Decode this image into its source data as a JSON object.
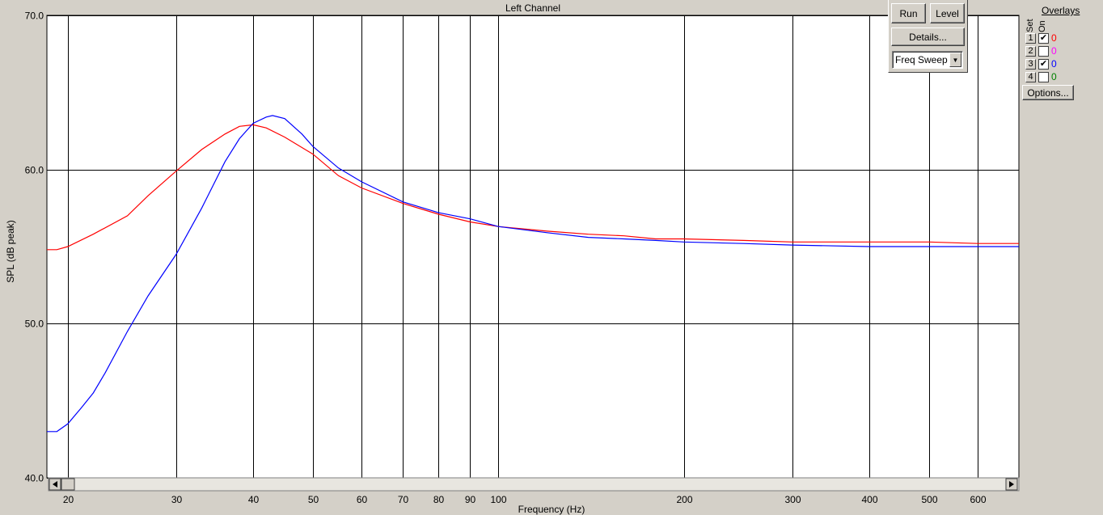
{
  "chart_data": {
    "type": "line",
    "title": "Left Channel",
    "xlabel": "Frequency (Hz)",
    "ylabel": "SPL (dB peak)",
    "xscale": "log",
    "xlim": [
      18.5,
      700
    ],
    "ylim": [
      40,
      70
    ],
    "grid": true,
    "x_ticks": [
      20,
      30,
      40,
      50,
      60,
      70,
      80,
      90,
      100,
      200,
      300,
      400,
      500,
      600
    ],
    "x_tick_labels": [
      "20",
      "30",
      "40",
      "50",
      "60",
      "70",
      "80",
      "90",
      "100",
      "200",
      "300",
      "400",
      "500",
      "600"
    ],
    "y_ticks": [
      40,
      50,
      60,
      70
    ],
    "y_tick_labels": [
      "40.0",
      "50.0",
      "60.0",
      "70.0"
    ],
    "series": [
      {
        "color": "#ff0000",
        "x": [
          18.5,
          19.2,
          20,
          22,
          25,
          27,
          30,
          33,
          36,
          38,
          40,
          42,
          45,
          50,
          55,
          60,
          70,
          80,
          90,
          100,
          120,
          140,
          160,
          180,
          200,
          250,
          300,
          400,
          500,
          600,
          700
        ],
        "y": [
          54.8,
          54.8,
          55.0,
          55.8,
          57.0,
          58.3,
          59.9,
          61.3,
          62.3,
          62.8,
          62.9,
          62.7,
          62.1,
          61.0,
          59.6,
          58.8,
          57.8,
          57.1,
          56.6,
          56.3,
          56.0,
          55.8,
          55.7,
          55.5,
          55.5,
          55.4,
          55.3,
          55.3,
          55.3,
          55.2,
          55.2
        ]
      },
      {
        "color": "#0000ff",
        "x": [
          18.5,
          19.2,
          20,
          21,
          22,
          23,
          25,
          27,
          30,
          33,
          36,
          38,
          40,
          42,
          43,
          45,
          48,
          50,
          55,
          60,
          70,
          80,
          90,
          100,
          120,
          140,
          160,
          180,
          200,
          250,
          300,
          400,
          500,
          600,
          700
        ],
        "y": [
          43.0,
          43.0,
          43.5,
          44.5,
          45.5,
          46.8,
          49.5,
          51.8,
          54.5,
          57.5,
          60.5,
          62.0,
          63.0,
          63.4,
          63.5,
          63.3,
          62.3,
          61.5,
          60.1,
          59.2,
          57.9,
          57.2,
          56.8,
          56.3,
          55.9,
          55.6,
          55.5,
          55.4,
          55.3,
          55.2,
          55.1,
          55.0,
          55.0,
          55.0,
          55.0
        ]
      }
    ]
  },
  "controls": {
    "run_label": "Run",
    "level_label": "Level",
    "details_label": "Details...",
    "mode_selected": "Freq Sweep"
  },
  "overlays": {
    "title": "Overlays",
    "set_label": "Set",
    "on_label": "On",
    "options_label": "Options...",
    "rows": [
      {
        "set": "1",
        "checked": true,
        "count": "0",
        "color": "#ff0000"
      },
      {
        "set": "2",
        "checked": false,
        "count": "0",
        "color": "#ff00ff"
      },
      {
        "set": "3",
        "checked": true,
        "count": "0",
        "color": "#0000ff"
      },
      {
        "set": "4",
        "checked": false,
        "count": "0",
        "color": "#008000"
      }
    ]
  }
}
